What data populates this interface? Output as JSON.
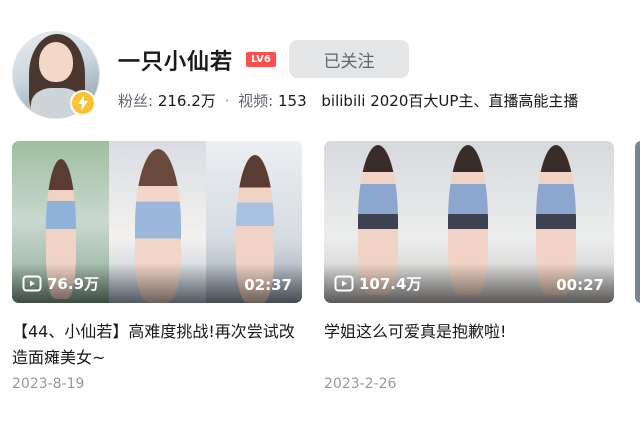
{
  "profile": {
    "name": "一只小仙若",
    "level": "LV6",
    "follow_label": "已关注",
    "fans_label": "粉丝:",
    "fans_value": "216.2万",
    "video_label": "视频:",
    "video_value": "153",
    "bio": "bilibili 2020百大UP主、直播高能主播"
  },
  "videos": [
    {
      "views": "76.9万",
      "duration": "02:37",
      "title": "【44、小仙若】高难度挑战!再次尝试改造面瘫美女~",
      "date": "2023-8-19"
    },
    {
      "views": "107.4万",
      "duration": "00:27",
      "title": "学姐这么可爱真是抱歉啦!",
      "date": "2023-2-26"
    }
  ],
  "colors": {
    "accent": "#fb7299",
    "verify": "#fdc12f",
    "level": "#ff4f4f"
  },
  "edge": {
    "text": "【"
  }
}
